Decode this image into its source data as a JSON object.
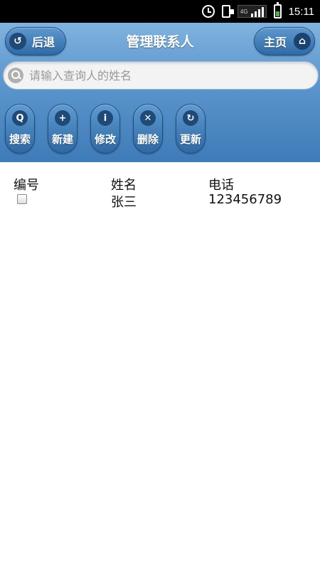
{
  "status_bar": {
    "network": "4G",
    "time": "15:11"
  },
  "header": {
    "title": "管理联系人",
    "back_label": "后退",
    "home_label": "主页"
  },
  "search": {
    "placeholder": "请输入查询人的姓名",
    "value": ""
  },
  "toolbar": [
    {
      "label": "搜索",
      "icon": "search-icon",
      "glyph": "Q"
    },
    {
      "label": "新建",
      "icon": "plus-icon",
      "glyph": "+"
    },
    {
      "label": "修改",
      "icon": "info-icon",
      "glyph": "i"
    },
    {
      "label": "删除",
      "icon": "delete-icon",
      "glyph": "✕"
    },
    {
      "label": "更新",
      "icon": "refresh-icon",
      "glyph": "↻"
    }
  ],
  "table": {
    "headers": [
      "编号",
      "姓名",
      "电话"
    ],
    "rows": [
      {
        "checked": false,
        "name": "张三",
        "phone": "123456789"
      }
    ]
  }
}
